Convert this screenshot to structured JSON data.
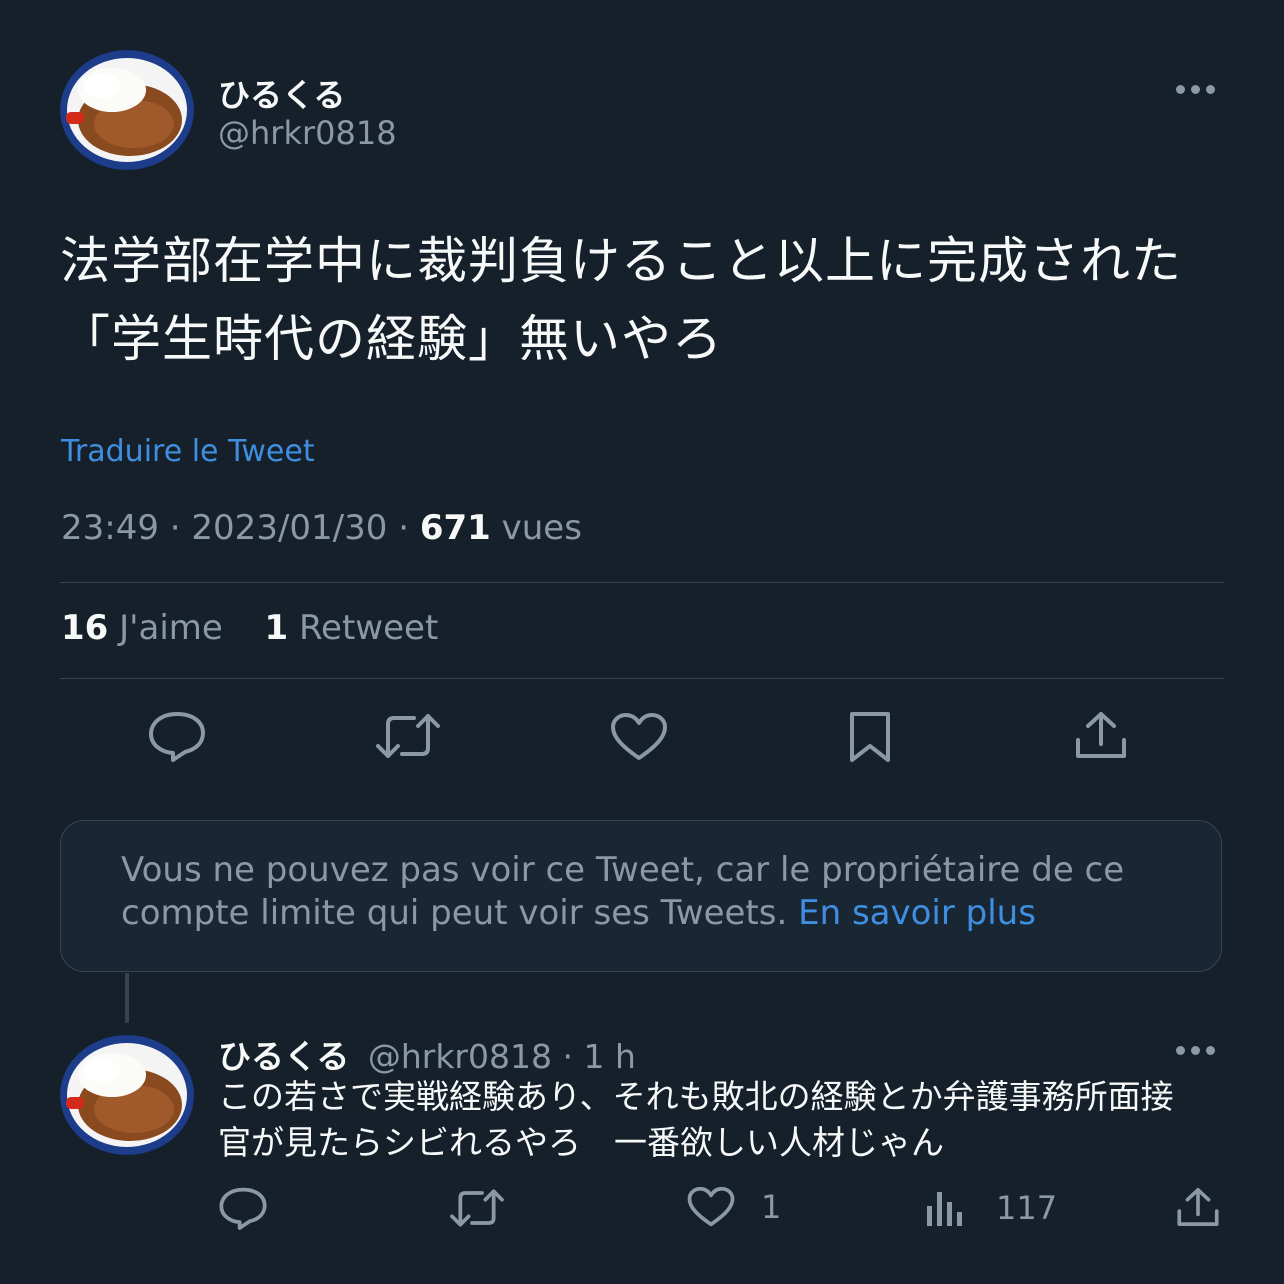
{
  "tweet": {
    "author_name": "ひるくる",
    "author_handle": "@hrkr0818",
    "text": "法学部在学中に裁判負けること以上に完成された「学生時代の経験」無いやろ",
    "translate_label": "Traduire le Tweet",
    "time": "23:49",
    "separator": "·",
    "date": "2023/01/30",
    "views_count": "671",
    "views_label": "vues",
    "likes_count": "16",
    "likes_label": "J'aime",
    "retweets_count": "1",
    "retweets_label": "Retweet"
  },
  "notice": {
    "text": "Vous ne pouvez pas voir ce Tweet, car le propriétaire de ce compte limite qui peut voir ses Tweets.",
    "link": "En savoir plus"
  },
  "reply": {
    "author_name": "ひるくる",
    "author_handle": "@hrkr0818",
    "time_ago": "· 1 h",
    "text": "この若さで実戦経験あり、それも敗北の経験とか弁護事務所面接官が見たらシビれるやろ　一番欲しい人材じゃん",
    "like_count": "1",
    "views_count": "117"
  },
  "icons": {
    "reply": "reply-icon",
    "retweet": "retweet-icon",
    "like": "heart-icon",
    "bookmark": "bookmark-icon",
    "share": "share-icon",
    "views": "analytics-icon",
    "more": "more-icon"
  },
  "colors": {
    "background": "#15202b",
    "text": "#f7f9f9",
    "secondary": "#8b98a5",
    "accent": "#3f8ee0",
    "border": "#38444d"
  }
}
